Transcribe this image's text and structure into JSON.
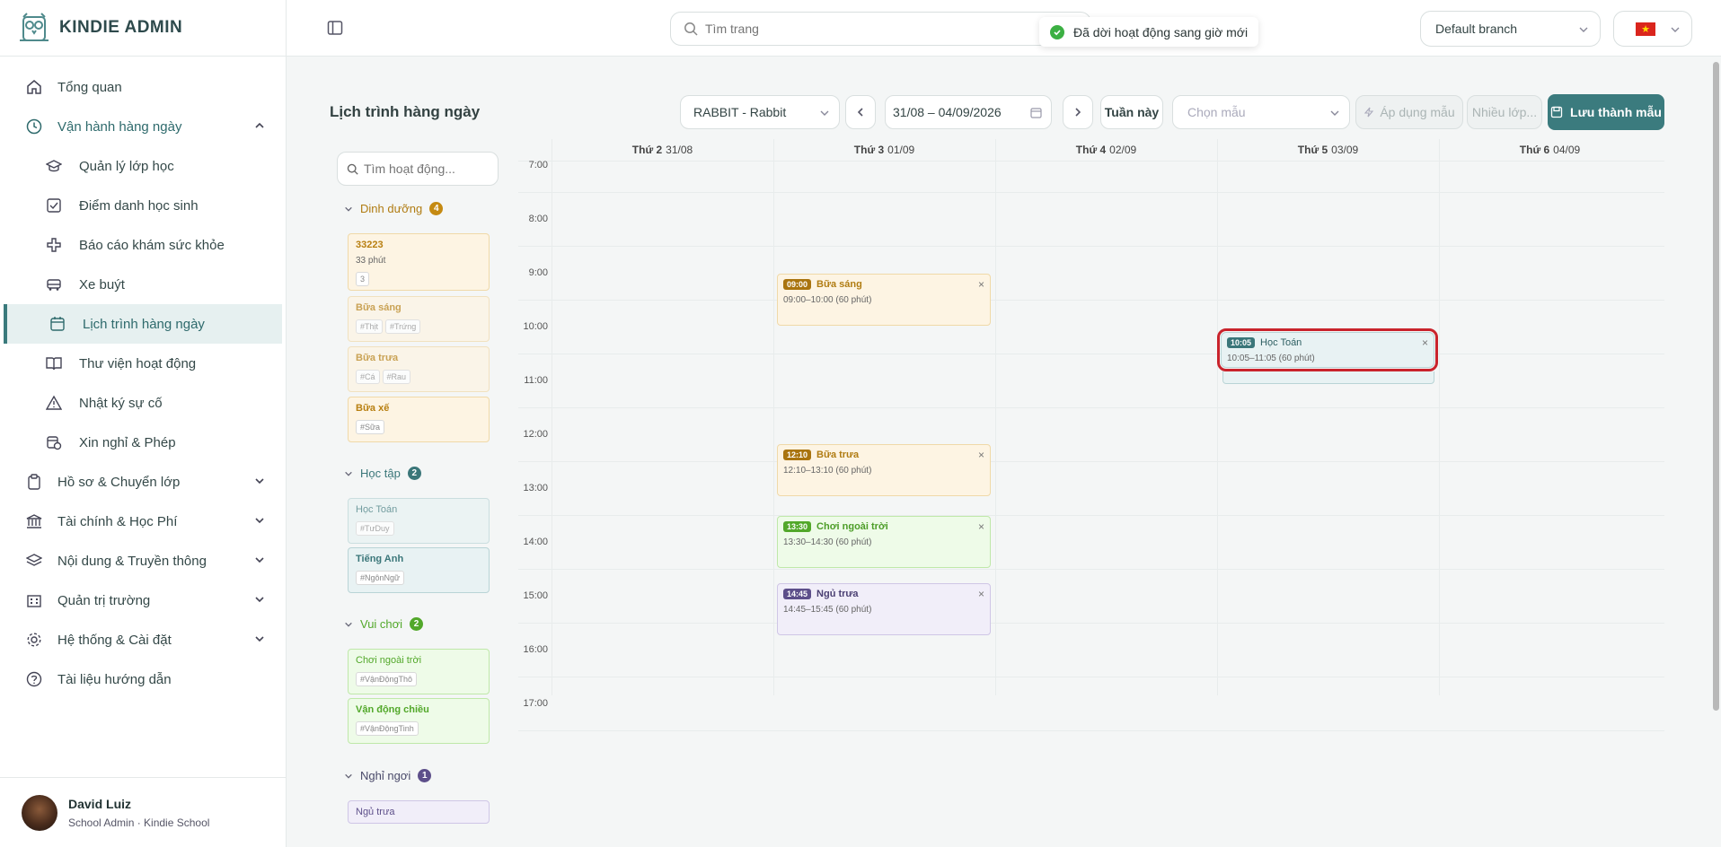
{
  "brand": {
    "name": "KINDIE ADMIN"
  },
  "sidebar": {
    "items": [
      {
        "label": "Tổng quan",
        "icon": "home-icon"
      },
      {
        "label": "Vận hành hàng ngày",
        "icon": "clock-icon"
      },
      {
        "label": "Quản lý lớp học",
        "icon": "graduation-cap-icon"
      },
      {
        "label": "Điểm danh học sinh",
        "icon": "checkbox-icon"
      },
      {
        "label": "Báo cáo khám sức khỏe",
        "icon": "medical-cross-icon"
      },
      {
        "label": "Xe buýt",
        "icon": "bus-icon"
      },
      {
        "label": "Lịch trình hàng ngày",
        "icon": "calendar-icon"
      },
      {
        "label": "Thư viện hoạt động",
        "icon": "book-icon"
      },
      {
        "label": "Nhật ký sự cố",
        "icon": "warning-icon"
      },
      {
        "label": "Xin nghỉ & Phép",
        "icon": "calendar-clock-icon"
      },
      {
        "label": "Hồ sơ & Chuyển lớp",
        "icon": "clipboard-icon"
      },
      {
        "label": "Tài chính & Học Phí",
        "icon": "bank-icon"
      },
      {
        "label": "Nội dung & Truyền thông",
        "icon": "layers-icon"
      },
      {
        "label": "Quản trị trường",
        "icon": "building-icon"
      },
      {
        "label": "Hệ thống & Cài đặt",
        "icon": "gear-icon"
      },
      {
        "label": "Tài liệu hướng dẫn",
        "icon": "help-icon"
      }
    ]
  },
  "user": {
    "name": "David Luiz",
    "role": "School Admin · Kindie School"
  },
  "header": {
    "search_placeholder": "Tìm trang",
    "toast": "Đã dời hoạt động sang giờ mới",
    "branch": "Default branch",
    "language": "vi"
  },
  "toolbar": {
    "title": "Lịch trình hàng ngày",
    "class_select": "RABBIT - Rabbit",
    "date_range": "31/08 – 04/09/2026",
    "this_week": "Tuần này",
    "template_placeholder": "Chọn mẫu",
    "apply_template": "Áp dụng mẫu",
    "multi_class": "Nhiều lớp...",
    "save_template": "Lưu thành mẫu"
  },
  "panel": {
    "search_placeholder": "Tìm hoạt động...",
    "groups": [
      {
        "name": "Dinh dưỡng",
        "count": "4",
        "color": "#c58a12"
      },
      {
        "name": "Học tập",
        "count": "2",
        "color": "#3a7679"
      },
      {
        "name": "Vui chơi",
        "count": "2",
        "color": "#52a82a"
      },
      {
        "name": "Nghỉ ngơi",
        "count": "1",
        "color": "#5d4f8a"
      }
    ],
    "cards": [
      {
        "title": "33223",
        "sub": "33 phút",
        "tags": [
          "3"
        ]
      },
      {
        "title": "Bữa sáng",
        "tags": [
          "#Thịt",
          "#Trứng"
        ]
      },
      {
        "title": "Bữa trưa",
        "tags": [
          "#Cá",
          "#Rau"
        ]
      },
      {
        "title": "Bữa xế",
        "tags": [
          "#Sữa"
        ]
      },
      {
        "title": "Học Toán",
        "tags": [
          "#TưDuy"
        ]
      },
      {
        "title": "Tiếng Anh",
        "tags": [
          "#NgônNgữ"
        ]
      },
      {
        "title": "Chơi ngoài trời",
        "tags": [
          "#VậnĐộngThô"
        ]
      },
      {
        "title": "Vận động chiều",
        "tags": [
          "#VậnĐộngTinh"
        ]
      },
      {
        "title": "Ngủ trưa",
        "tags": []
      }
    ]
  },
  "calendar": {
    "days": [
      {
        "dow": "Thứ 2",
        "date": "31/08"
      },
      {
        "dow": "Thứ 3",
        "date": "01/09"
      },
      {
        "dow": "Thứ 4",
        "date": "02/09"
      },
      {
        "dow": "Thứ 5",
        "date": "03/09"
      },
      {
        "dow": "Thứ 6",
        "date": "04/09"
      }
    ],
    "hours": [
      "7:00",
      "8:00",
      "9:00",
      "10:00",
      "11:00",
      "12:00",
      "13:00",
      "14:00",
      "15:00",
      "16:00",
      "17:00"
    ],
    "events": [
      {
        "day": 1,
        "start": "09:00",
        "title": "Bữa sáng",
        "range": "09:00–10:00 (60 phút)",
        "kind": "nutrition"
      },
      {
        "day": 1,
        "start": "12:10",
        "title": "Bữa trưa",
        "range": "12:10–13:10 (60 phút)",
        "kind": "nutrition"
      },
      {
        "day": 1,
        "start": "13:30",
        "title": "Chơi ngoài trời",
        "range": "13:30–14:30 (60 phút)",
        "kind": "play"
      },
      {
        "day": 1,
        "start": "14:45",
        "title": "Ngủ trưa",
        "range": "14:45–15:45 (60 phút)",
        "kind": "rest"
      },
      {
        "day": 3,
        "start": "10:05",
        "title": "Học Toán",
        "range": "10:05–11:05 (60 phút)",
        "kind": "study",
        "selected": true
      }
    ],
    "close_symbol": "×"
  }
}
